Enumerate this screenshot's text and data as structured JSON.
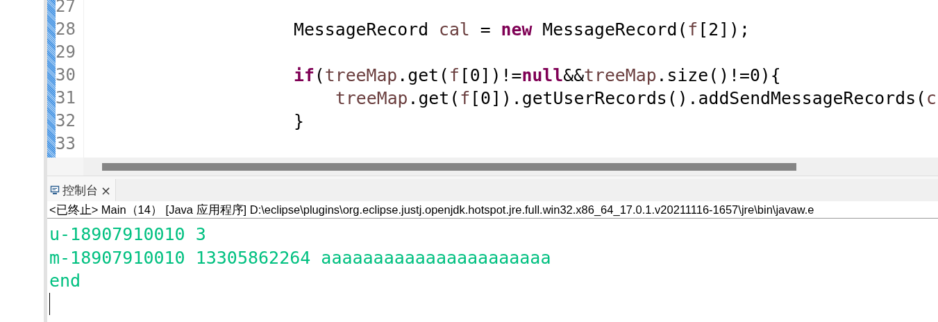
{
  "editor": {
    "lines": [
      {
        "number": "27"
      },
      {
        "number": "28",
        "kind": "block",
        "tokens": [
          {
            "kind": "plain",
            "text": "MessageRecord "
          },
          {
            "kind": "var",
            "text": "cal"
          },
          {
            "kind": "plain",
            "text": " = "
          },
          {
            "kind": "keyword",
            "text": "new"
          },
          {
            "kind": "plain",
            "text": " MessageRecord("
          },
          {
            "kind": "var",
            "text": "f"
          },
          {
            "kind": "plain",
            "text": "[2]);"
          }
        ]
      },
      {
        "number": "29"
      },
      {
        "number": "30",
        "kind": "block",
        "tokens": [
          {
            "kind": "keyword",
            "text": "if"
          },
          {
            "kind": "plain",
            "text": "("
          },
          {
            "kind": "var",
            "text": "treeMap"
          },
          {
            "kind": "plain",
            "text": ".get("
          },
          {
            "kind": "var",
            "text": "f"
          },
          {
            "kind": "plain",
            "text": "[0])!="
          },
          {
            "kind": "keyword",
            "text": "null"
          },
          {
            "kind": "plain",
            "text": "&&"
          },
          {
            "kind": "var",
            "text": "treeMap"
          },
          {
            "kind": "plain",
            "text": ".size()!=0){"
          }
        ]
      },
      {
        "number": "31",
        "kind": "nested",
        "tokens": [
          {
            "kind": "var",
            "text": "treeMap"
          },
          {
            "kind": "plain",
            "text": ".get("
          },
          {
            "kind": "var",
            "text": "f"
          },
          {
            "kind": "plain",
            "text": "[0]).getUserRecords().addSendMessageRecords("
          },
          {
            "kind": "var",
            "text": "c"
          }
        ]
      },
      {
        "number": "32",
        "kind": "block",
        "tokens": [
          {
            "kind": "plain",
            "text": "}"
          }
        ]
      },
      {
        "number": "33"
      }
    ]
  },
  "console": {
    "tab": {
      "label": "控制台",
      "close": "×",
      "selected": true
    },
    "status": "<已终止> Main（14）  [Java 应用程序] D:\\eclipse\\plugins\\org.eclipse.justj.openjdk.hotspot.jre.full.win32.x86_64_17.0.1.v20211116-1657\\jre\\bin\\javaw.e",
    "output": [
      "u-18907910010 3",
      "m-18907910010 13305862264 aaaaaaaaaaaaaaaaaaaaaa",
      "end"
    ]
  }
}
